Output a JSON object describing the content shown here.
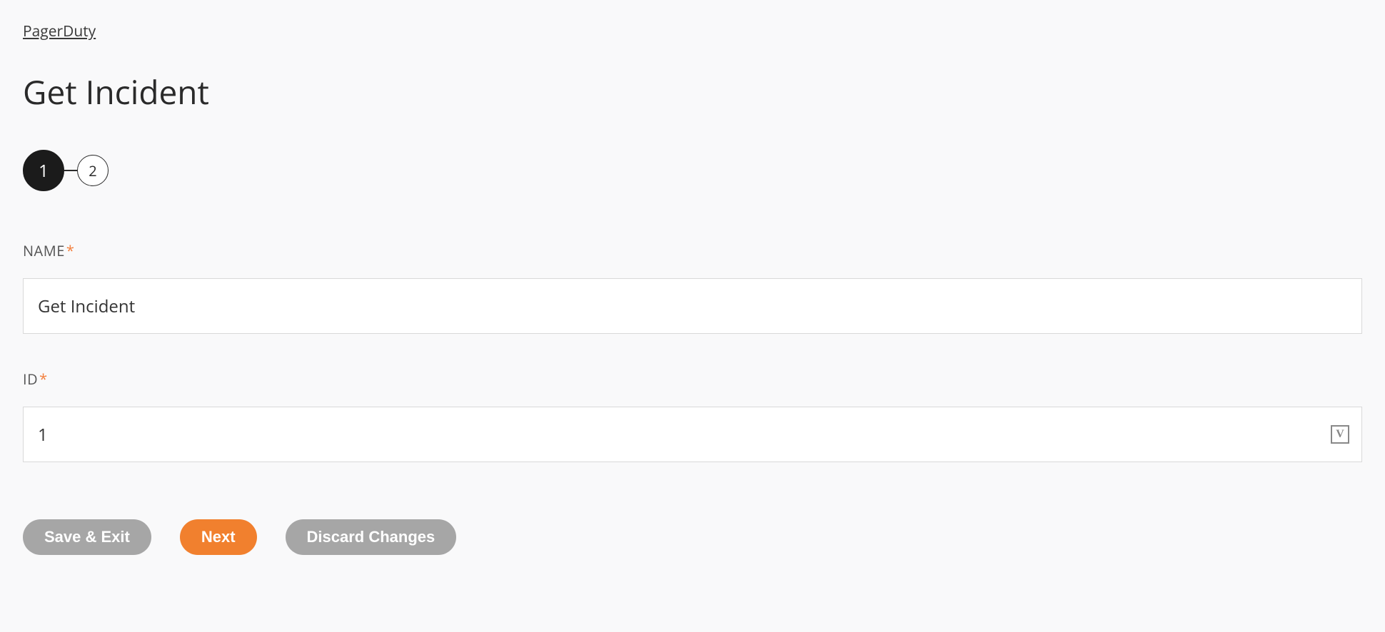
{
  "breadcrumb": "PagerDuty",
  "title": "Get Incident",
  "stepper": {
    "steps": [
      "1",
      "2"
    ],
    "active_index": 0
  },
  "form": {
    "name_label": "NAME",
    "name_value": "Get Incident",
    "id_label": "ID",
    "id_value": "1",
    "required_marker": "*",
    "var_icon_label": "V"
  },
  "buttons": {
    "save_exit": "Save & Exit",
    "next": "Next",
    "discard": "Discard Changes"
  }
}
